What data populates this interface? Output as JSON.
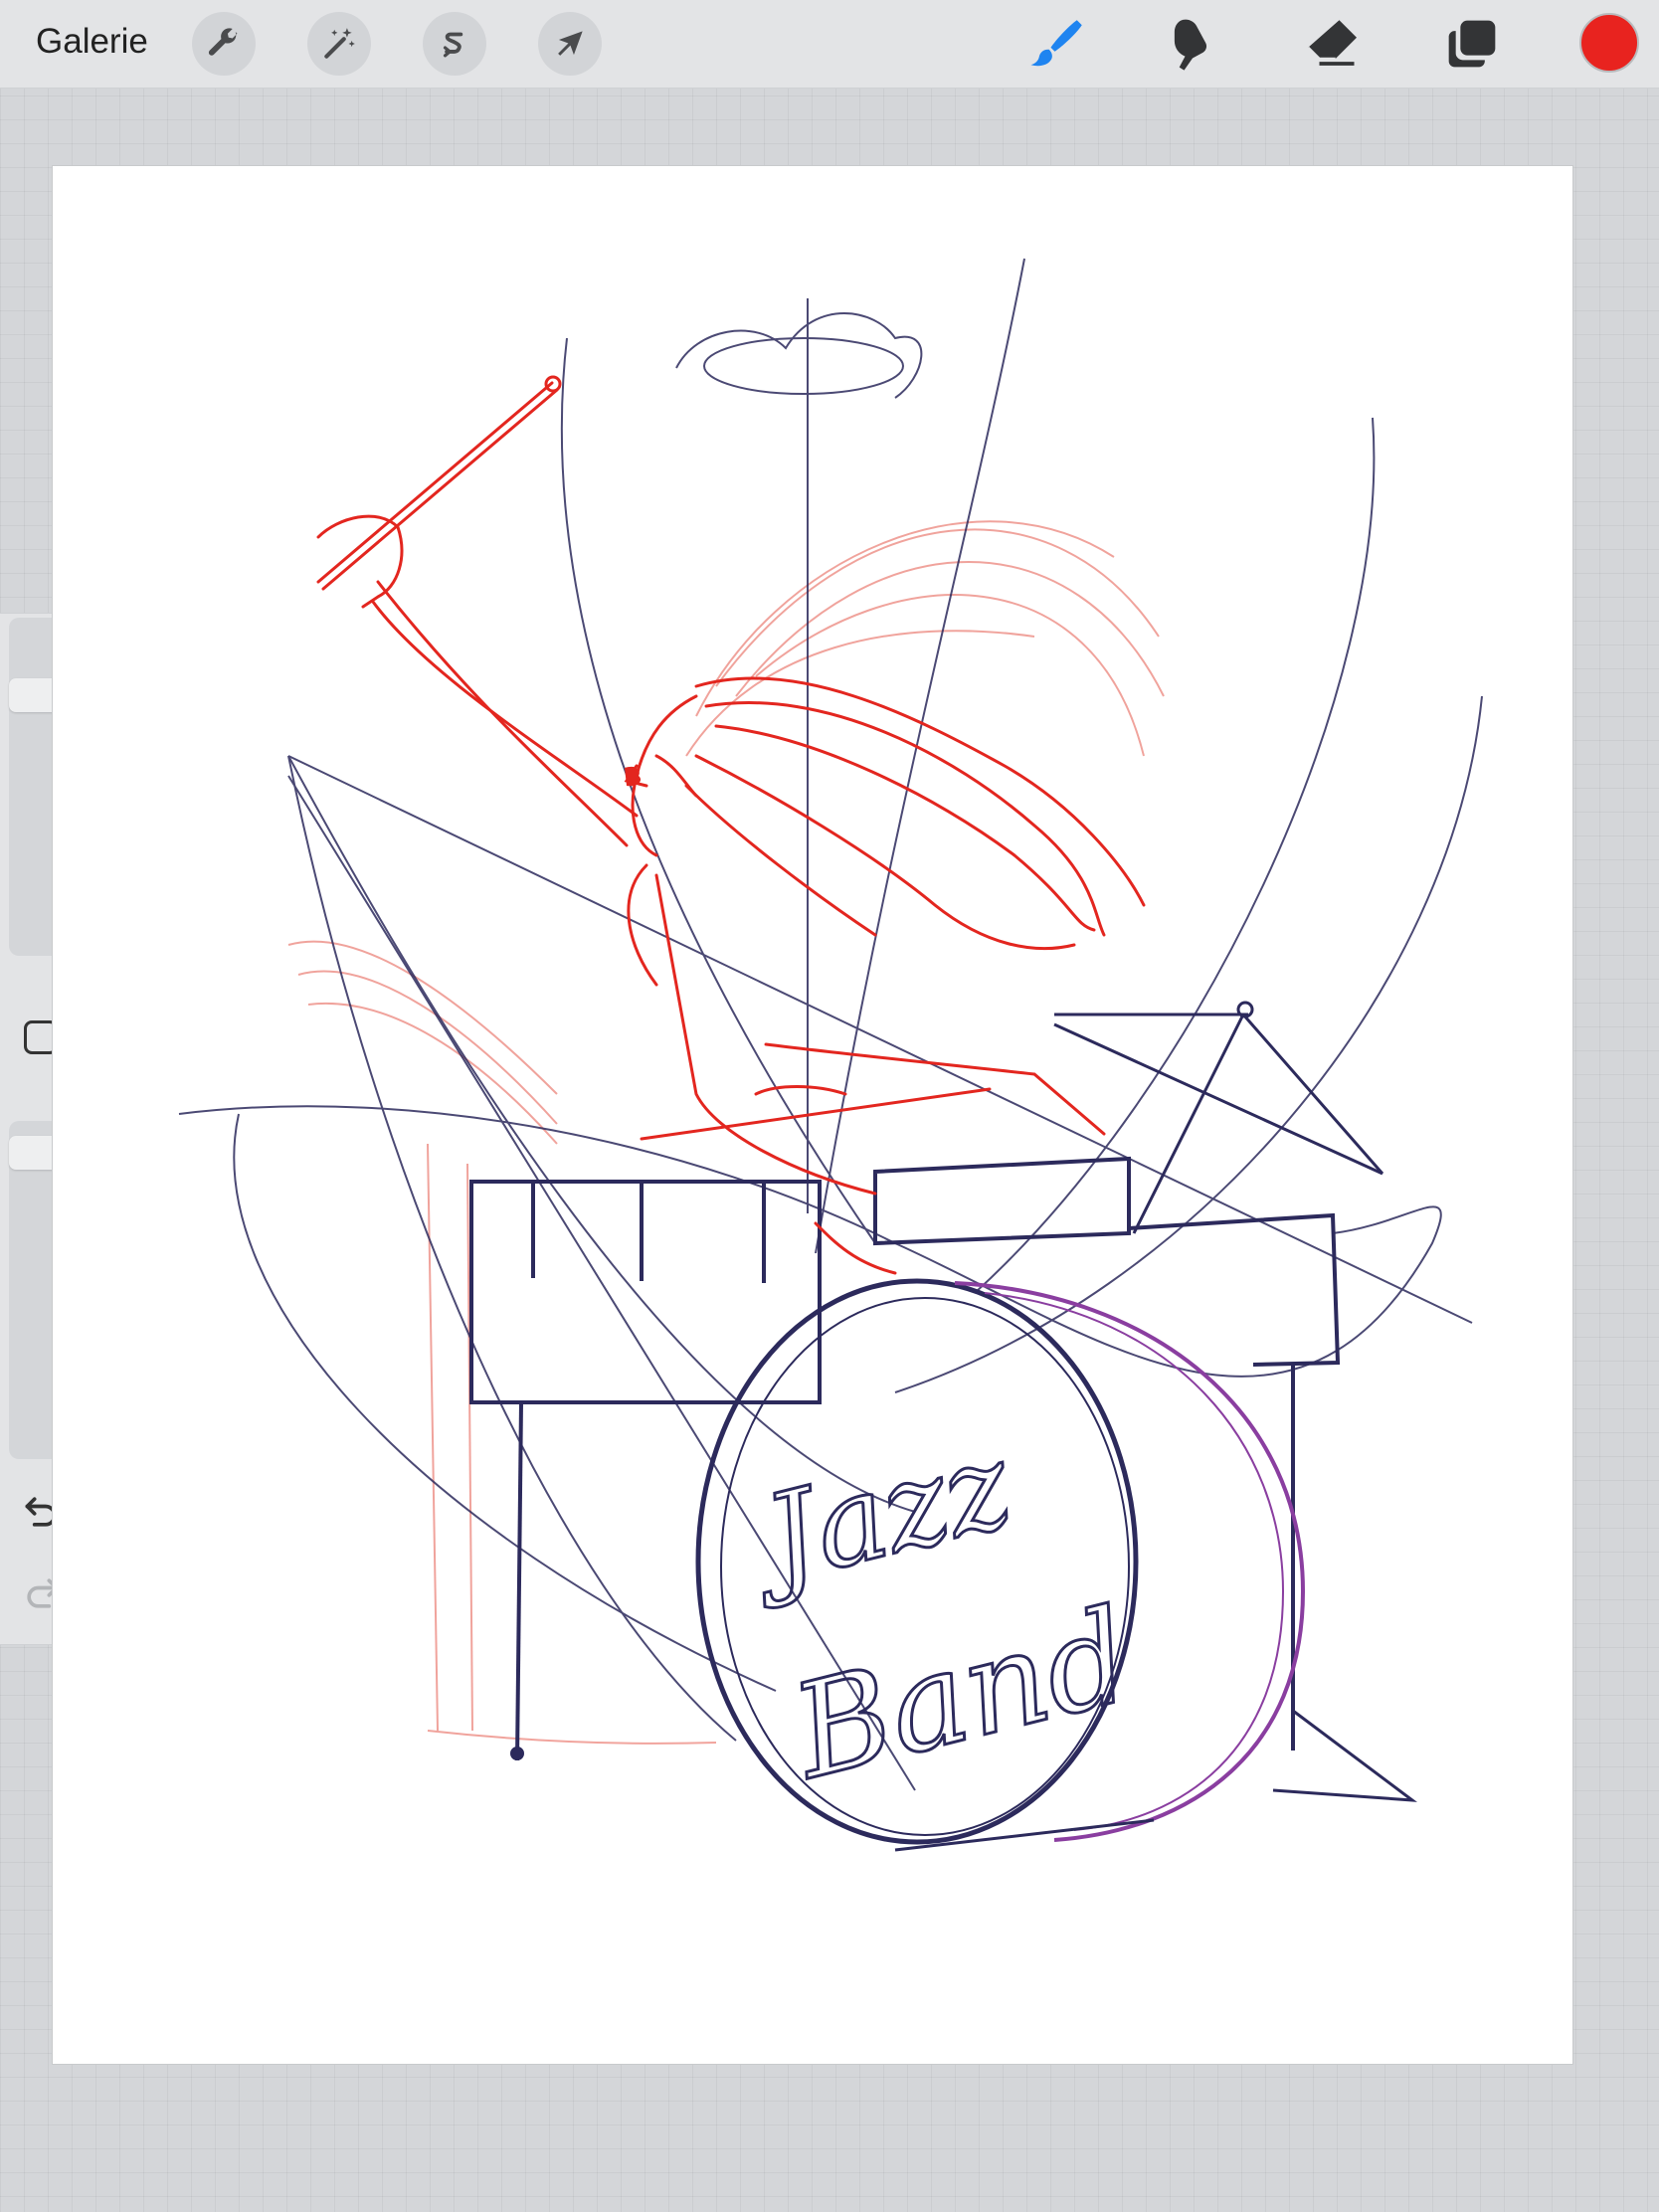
{
  "app": {
    "name": "Procreate"
  },
  "topbar": {
    "gallery_label": "Galerie",
    "left_tools": [
      {
        "name": "actions",
        "icon": "wrench-icon"
      },
      {
        "name": "adjustments",
        "icon": "magic-wand-icon"
      },
      {
        "name": "selection",
        "icon": "selection-s-icon"
      },
      {
        "name": "transform",
        "icon": "arrow-cursor-icon"
      }
    ],
    "right_tools": [
      {
        "name": "brush",
        "icon": "brush-icon",
        "active": true
      },
      {
        "name": "smudge",
        "icon": "smudge-finger-icon",
        "active": false
      },
      {
        "name": "eraser",
        "icon": "eraser-icon",
        "active": false
      },
      {
        "name": "layers",
        "icon": "layers-icon",
        "active": false
      }
    ],
    "current_color": "#e8231f"
  },
  "sidebar": {
    "brush_size_level": 0.2,
    "opacity_level": 0.05,
    "modify_icon": "square-icon",
    "undo_icon": "undo-arrow-icon",
    "redo_icon": "redo-arrow-icon"
  },
  "canvas": {
    "background": "#ffffff",
    "sketch_colors": {
      "red": "#e3261f",
      "light_red": "#ef9a92",
      "navy": "#2c2a5c",
      "purple": "#8a3ea0"
    },
    "drum_text_line1": "Jazz",
    "drum_text_line2": "Band"
  }
}
